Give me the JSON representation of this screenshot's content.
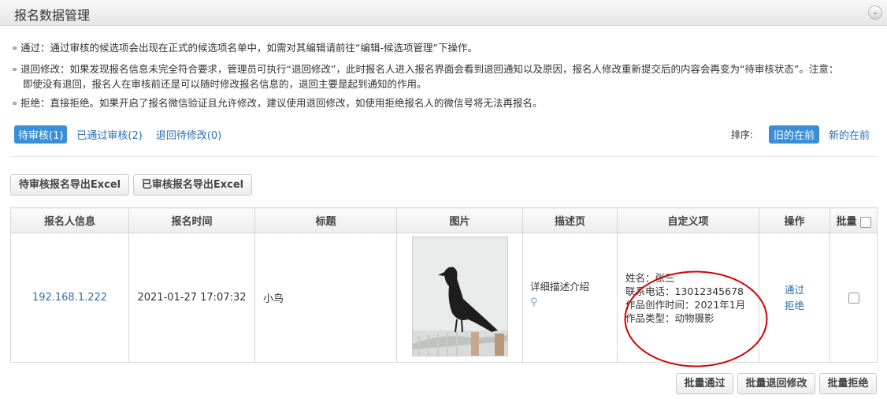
{
  "header": {
    "title": "报名数据管理",
    "collapse_icon": "chevron-down-icon"
  },
  "tips": {
    "approve": "通过：通过审核的候选项会出现在正式的候选项名单中，如需对其编辑请前往“编辑-候选项管理”下操作。",
    "return_line1": "退回修改：如果发现报名信息未完全符合要求，管理员可执行“退回修改”，此时报名人进入报名界面会看到退回通知以及原因，报名人修改重新提交后的内容会再变为“待审核状态”。注意：",
    "return_line2": "即使没有退回，报名人在审核前还是可以随时修改报名信息的，退回主要是起到通知的作用。",
    "reject": "拒绝：直接拒绝。如果开启了报名微信验证且允许修改，建议使用退回修改，如使用拒绝报名人的微信号将无法再报名。"
  },
  "tabs": [
    {
      "label": "待审核(1)",
      "active": true
    },
    {
      "label": "已通过审核(2)",
      "active": false
    },
    {
      "label": "退回待修改(0)",
      "active": false
    }
  ],
  "sort": {
    "label": "排序:",
    "options": [
      {
        "label": "旧的在前",
        "active": true
      },
      {
        "label": "新的在前",
        "active": false
      }
    ]
  },
  "export": {
    "pending": "待审核报名导出Excel",
    "reviewed": "已审核报名导出Excel"
  },
  "table": {
    "headers": [
      "报名人信息",
      "报名时间",
      "标题",
      "图片",
      "描述页",
      "自定义项",
      "操作",
      "批量"
    ],
    "rows": [
      {
        "ip": "192.168.1.222",
        "time": "2021-01-27 17:07:32",
        "title": "小鸟",
        "image": "crow-photo",
        "desc": "详细描述介绍",
        "custom": [
          "姓名：张三",
          "联系电话：13012345678",
          "作品创作时间：2021年1月",
          "作品类型：动物摄影"
        ],
        "actions": [
          "通过",
          "拒绝"
        ]
      }
    ]
  },
  "batch": {
    "approve": "批量通过",
    "return": "批量退回修改",
    "reject": "批量拒绝"
  },
  "colors": {
    "accent": "#3a8fd8",
    "link": "#2a6fb4",
    "annotation": "#d00000"
  }
}
